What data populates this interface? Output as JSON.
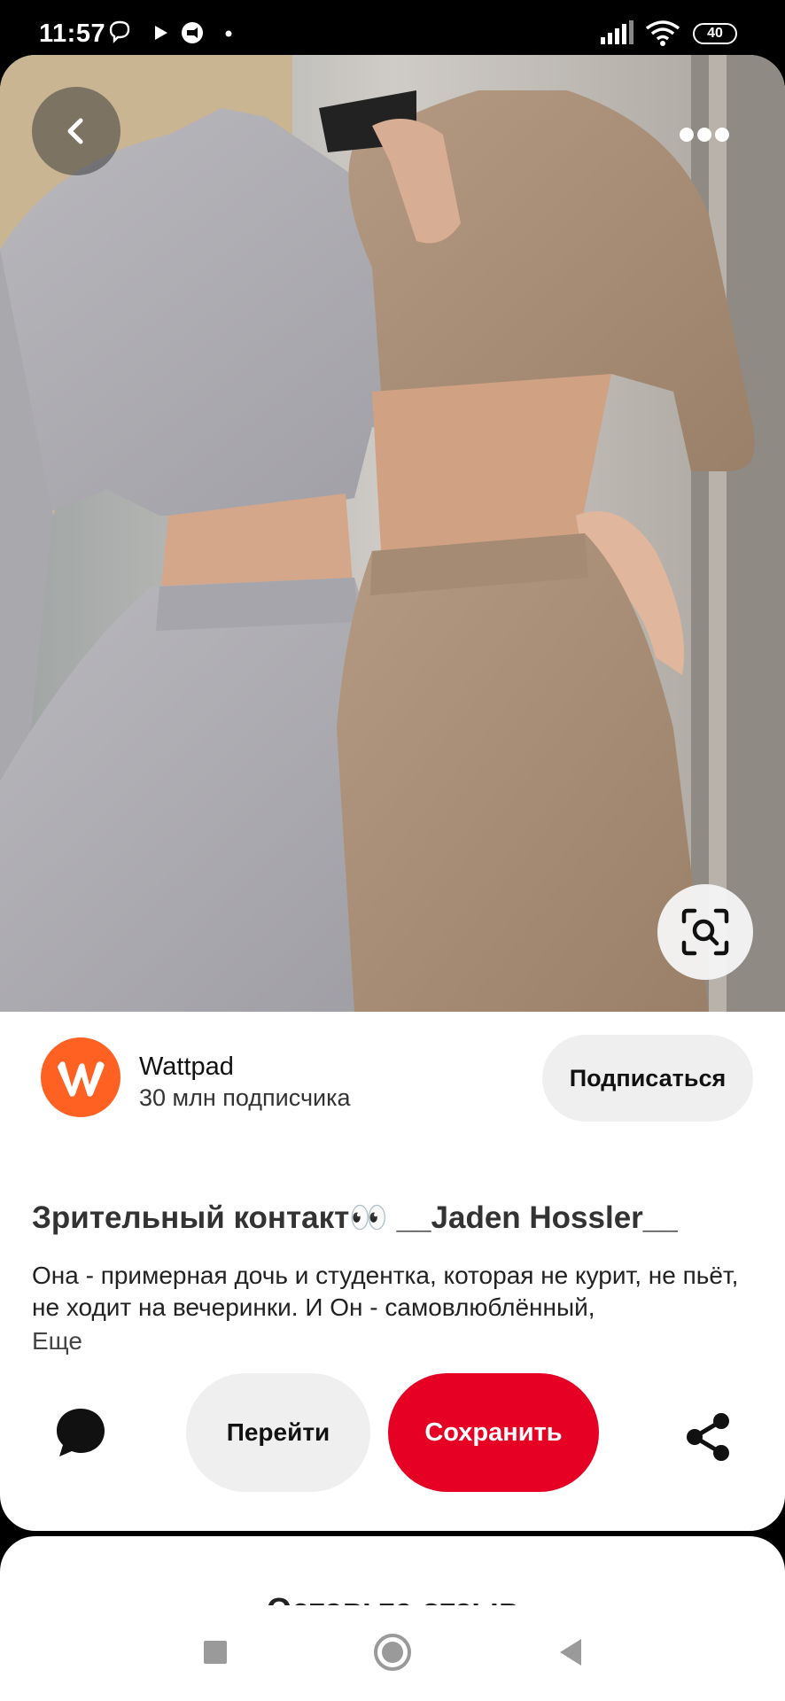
{
  "status_bar": {
    "time": "11:57",
    "battery": "40",
    "icons": [
      "viber-icon",
      "play-icon",
      "app-notification-icon",
      "dot-icon",
      "signal-icon",
      "wifi-icon",
      "battery-icon"
    ]
  },
  "pin": {
    "image_alt": "Two women in matching crop tops and wide-leg pants, gray and beige",
    "back_icon": "chevron-left-icon",
    "more_icon": "more-dots-icon",
    "lens_icon": "visual-search-icon"
  },
  "creator": {
    "name": "Wattpad",
    "followers": "30 млн подписчика",
    "follow_label": "Подписаться",
    "brand_color": "#ff6122"
  },
  "content": {
    "title": "Зрительный контакт👀 __Jaden Hossler__",
    "description": "Она - примерная дочь и студентка, которая не курит, не пьёт, не ходит на вечеринки. И Он - самовлюблённый,",
    "more_label": "Еще"
  },
  "actions": {
    "go_label": "Перейти",
    "save_label": "Сохранить",
    "save_color": "#e60023",
    "comment_icon": "comment-bubble-icon",
    "share_icon": "share-icon"
  },
  "review": {
    "title": "Оставьте отзыв"
  },
  "nav": {
    "items": [
      "recents-square-icon",
      "home-circle-icon",
      "back-triangle-icon"
    ]
  }
}
